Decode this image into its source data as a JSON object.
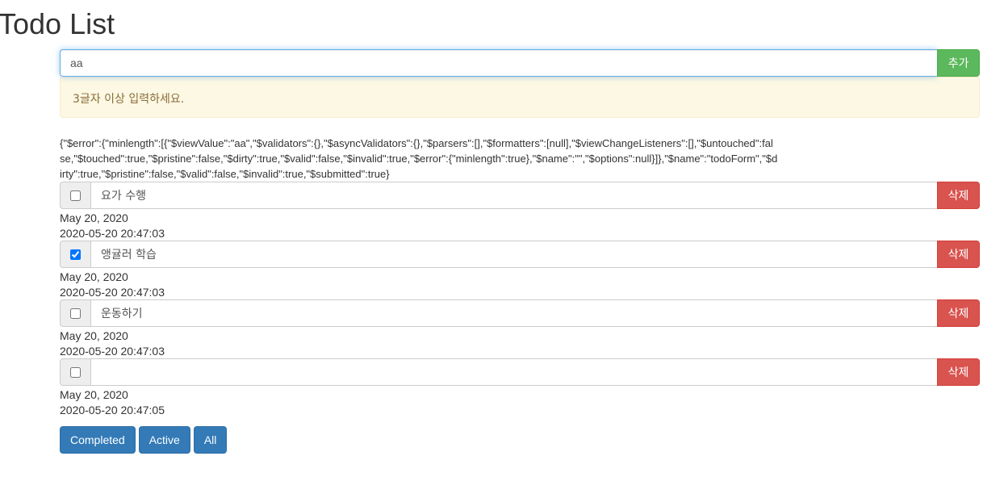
{
  "page_title": "Todo List",
  "new_todo": {
    "value": "aa",
    "add_label": "추가"
  },
  "warning_text": "3글자 이상 입력하세요.",
  "form_debug": "{\"$error\":{\"minlength\":[{\"$viewValue\":\"aa\",\"$validators\":{},\"$asyncValidators\":{},\"$parsers\":[],\"$formatters\":[null],\"$viewChangeListeners\":[],\"$untouched\":false,\"$touched\":true,\"$pristine\":false,\"$dirty\":true,\"$valid\":false,\"$invalid\":true,\"$error\":{\"minlength\":true},\"$name\":\"\",\"$options\":null}]},\"$name\":\"todoForm\",\"$dirty\":true,\"$pristine\":false,\"$valid\":false,\"$invalid\":true,\"$submitted\":true}",
  "todos": [
    {
      "title": "요가 수행",
      "done": false,
      "date": "May 20, 2020",
      "datetime": "2020-05-20 20:47:03",
      "delete_label": "삭제"
    },
    {
      "title": "앵귤러 학습",
      "done": true,
      "date": "May 20, 2020",
      "datetime": "2020-05-20 20:47:03",
      "delete_label": "삭제"
    },
    {
      "title": "운동하기",
      "done": false,
      "date": "May 20, 2020",
      "datetime": "2020-05-20 20:47:03",
      "delete_label": "삭제"
    },
    {
      "title": "",
      "done": false,
      "date": "May 20, 2020",
      "datetime": "2020-05-20 20:47:05",
      "delete_label": "삭제"
    }
  ],
  "filters": {
    "completed": "Completed",
    "active": "Active",
    "all": "All"
  },
  "colors": {
    "add_button": "#5cb85c",
    "delete_button": "#d9534f",
    "filter_button": "#337ab7",
    "warning_bg": "#fcf8e3"
  }
}
